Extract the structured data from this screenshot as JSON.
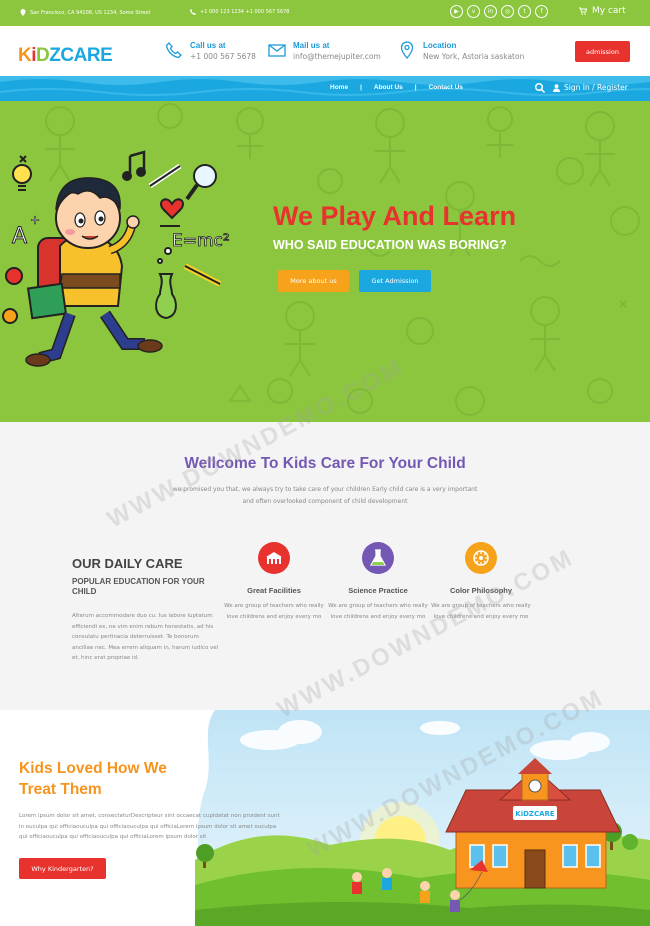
{
  "topbar": {
    "address": "San Francisco, CA 94108, US 1234, Some Street",
    "phones": "+1 000 123 1234   +1 000 567 5678",
    "social_icons": [
      "youtube-icon",
      "vimeo-icon",
      "linkedin-icon",
      "instagram-icon",
      "twitter-icon",
      "facebook-icon"
    ],
    "cart_label": "My cart"
  },
  "header": {
    "logo": {
      "letters": [
        "K",
        "i",
        "D",
        "Z",
        "C",
        "A",
        "R",
        "E"
      ],
      "colors": [
        "#f7941d",
        "#e8322d",
        "#8cc63f",
        "#1ba8e0",
        "#1ba8e0",
        "#1ba8e0",
        "#1ba8e0",
        "#1ba8e0"
      ]
    },
    "call_title": "Call us at",
    "call_value": "+1 000 567 5678",
    "mail_title": "Mail us at",
    "mail_value": "info@themejupiter.com",
    "location_title": "Location",
    "location_value": "New York, Astoria saskaton",
    "admission_button": "admission"
  },
  "nav": {
    "items": [
      "Home",
      "About Us",
      "Contact Us"
    ],
    "login": "Sign In / Register"
  },
  "hero": {
    "title": "We Play And Learn",
    "subtitle": "WHO SAID EDUCATION WAS BORING?",
    "btn_more": "More about us",
    "btn_admission": "Get Admission"
  },
  "welcome": {
    "title": "Wellcome To Kids Care For Your Child",
    "text": "we promised you that, we always try to take care of your children Early child care is a very important and often overlooked component of child development",
    "daily_title": "OUR DAILY CARE",
    "daily_sub": "POPULAR EDUCATION FOR YOUR CHILD",
    "daily_text": "Alterum accommodare duo cu. Ius labore luptatum efficiendi ex, ne vim enim rebum honestatis, ad his consulatu pertinacia deterruisset. Te bonorum ancillae nec. Mea errem aliquam in, harum iudico vel et, hinc erat propriae id.",
    "features": [
      {
        "title": "Great Facilities",
        "text": "We are group of teachers who really love childrens and enjoy every mo",
        "icon": "school-icon",
        "color": "#e8322d"
      },
      {
        "title": "Science Practice",
        "text": "We are group of teachers who really love childrens and enjoy every mo",
        "icon": "flask-icon",
        "color": "#7458b4"
      },
      {
        "title": "Color Philosophy",
        "text": "We are group of teachers who really love childrens and enjoy every mo",
        "icon": "palette-icon",
        "color": "#f7a21b"
      }
    ]
  },
  "kids": {
    "title": "Kids Loved How We Treat Them",
    "text": "Lorem ipsum dolor sit amet, consecteturDescripteur sint occaecat cupidatat non proident sunt in ouculpa qui officiaouculpa qui officiaouculpa qui officiaLorem ipsum dolor sit amet ouculpa qui officiaouculpa qui officiaouculpa qui officiaLorem ipsum dolor sit",
    "button": "Why Kindergarten?",
    "school_sign": "KiDZCARE"
  },
  "watermark": "WWW.DOWNDEMO.COM"
}
